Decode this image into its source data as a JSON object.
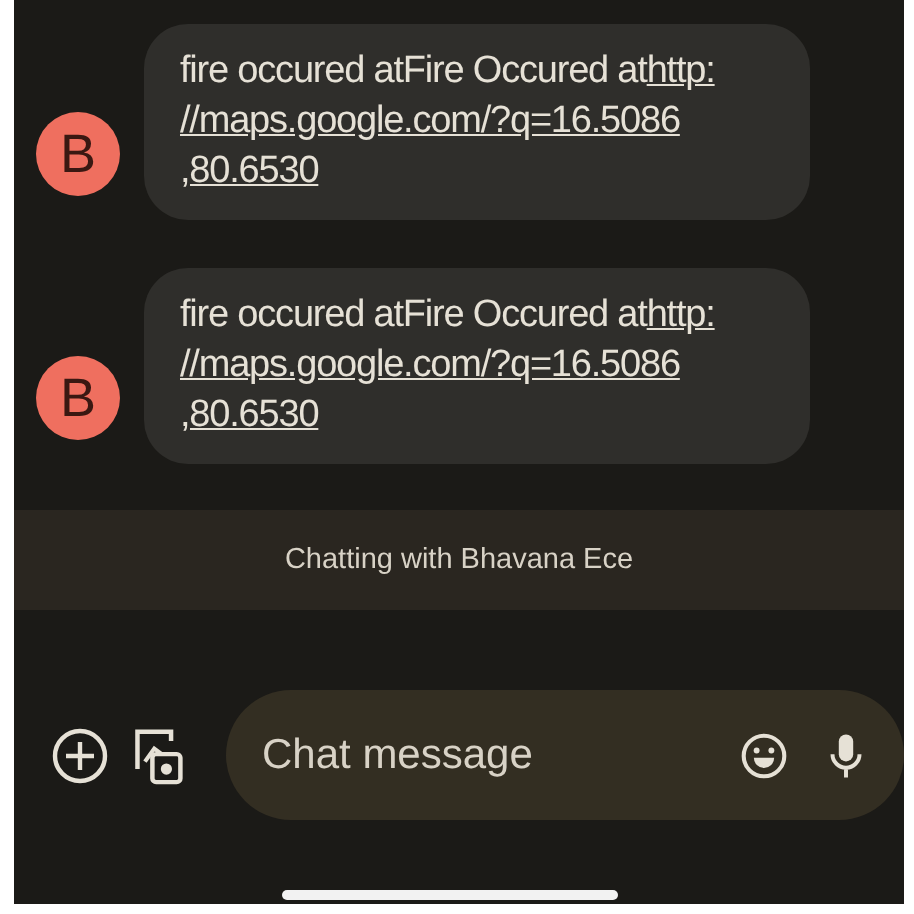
{
  "messages": [
    {
      "avatar": "B",
      "text": "fire occured atFire Occured at",
      "link_lines": [
        "http:",
        "//maps.google.com/?q=16.5086",
        ",80.6530"
      ]
    },
    {
      "avatar": "B",
      "text": "fire occured atFire Occured at",
      "link_lines": [
        "http:",
        "//maps.google.com/?q=16.5086",
        ",80.6530"
      ]
    }
  ],
  "banner": "Chatting with Bhavana Ece",
  "composer": {
    "placeholder": "Chat message"
  }
}
